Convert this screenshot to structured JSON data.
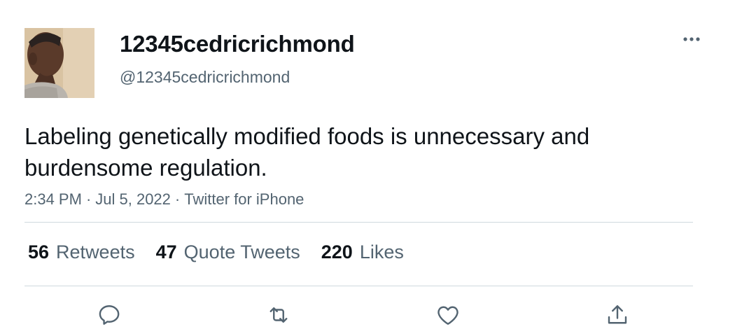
{
  "author": {
    "display_name": "12345cedricrichmond",
    "handle": "@12345cedricrichmond",
    "avatar_icon": "profile-photo"
  },
  "tweet": {
    "text": "Labeling genetically modified foods is unnecessary and burdensome regulation.",
    "time": "2:34 PM",
    "date": "Jul 5, 2022",
    "source": "Twitter for iPhone",
    "separator": "·"
  },
  "stats": {
    "retweets": {
      "count": "56",
      "label": "Retweets"
    },
    "quote_tweets": {
      "count": "47",
      "label": "Quote Tweets"
    },
    "likes": {
      "count": "220",
      "label": "Likes"
    }
  },
  "actions": {
    "reply_icon": "reply-icon",
    "retweet_icon": "retweet-icon",
    "like_icon": "heart-icon",
    "share_icon": "share-icon"
  },
  "colors": {
    "primary_text": "#0f1419",
    "secondary_text": "#536471",
    "divider": "#cfd9de"
  }
}
